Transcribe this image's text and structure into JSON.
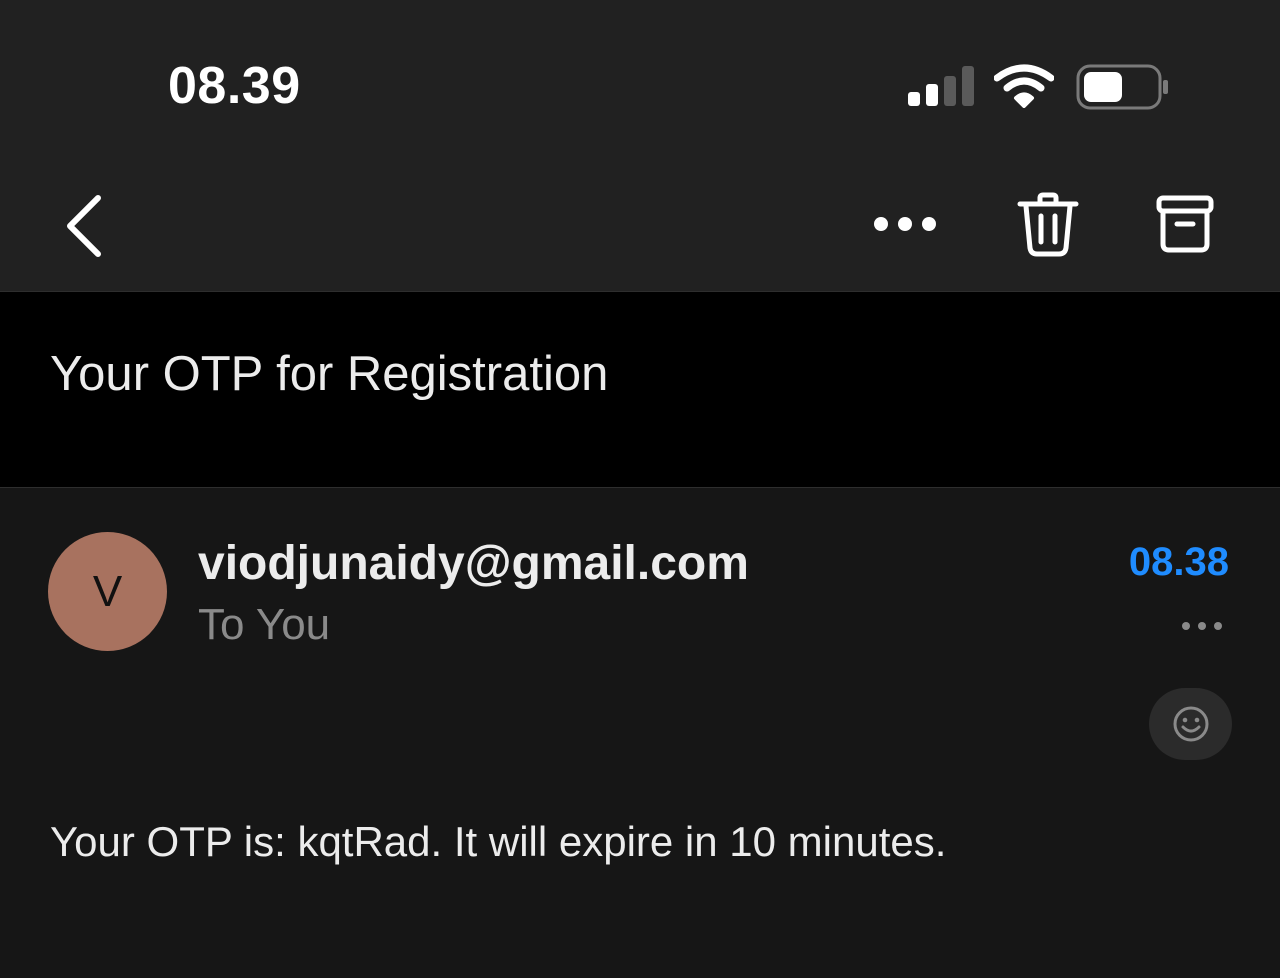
{
  "status_bar": {
    "time": "08.39",
    "signal_icon": "cellular-signal-icon",
    "wifi_icon": "wifi-icon",
    "battery_icon": "battery-icon"
  },
  "toolbar": {
    "back_icon": "chevron-left-icon",
    "more_icon": "ellipsis-icon",
    "delete_icon": "trash-icon",
    "archive_icon": "archive-icon"
  },
  "email": {
    "subject": "Your OTP for Registration",
    "sender_initial": "V",
    "sender": "viodjunaidy@gmail.com",
    "recipient": "To You",
    "time": "08.38",
    "body": "Your OTP is: kqtRad. It will expire in 10 minutes."
  },
  "colors": {
    "accent": "#1f8cff",
    "avatar": "#a8725f"
  }
}
